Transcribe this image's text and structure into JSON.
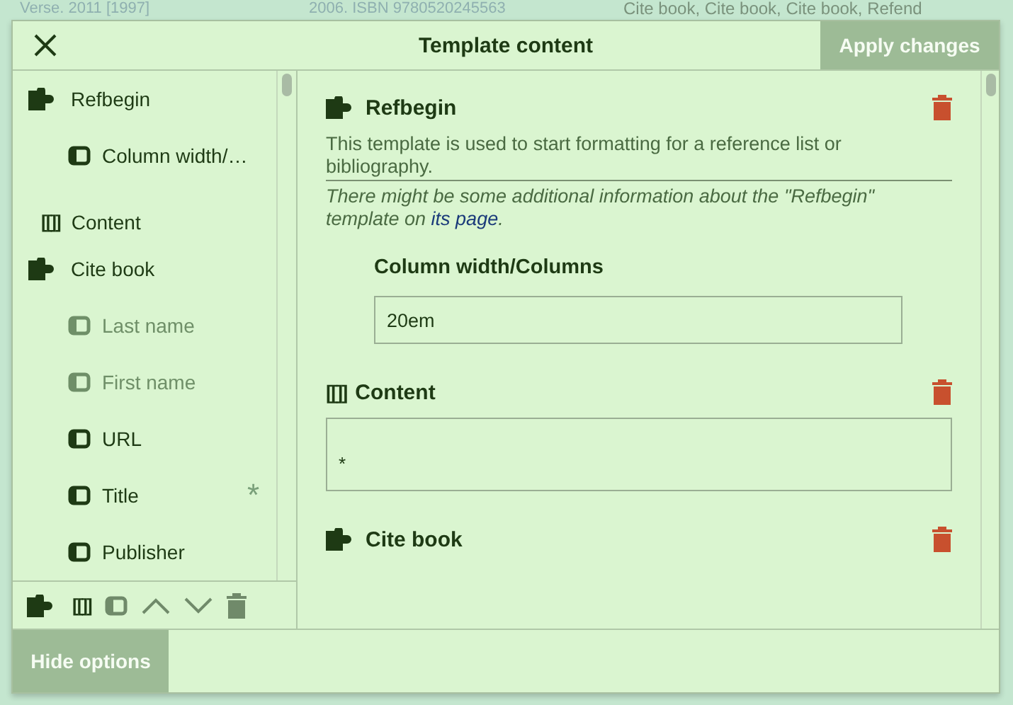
{
  "backdrop": {
    "texts": [
      "Verse. 2011 [1997]",
      "2006. ISBN 9780520245563",
      "Cite book, Cite book, Cite book, Refend"
    ]
  },
  "dialog": {
    "title": "Template content",
    "apply_button": {
      "label": "Apply changes",
      "disabled": true
    },
    "footer_button": "Hide options"
  },
  "sidebar": {
    "items": [
      {
        "kind": "template",
        "label": "Refbegin",
        "disabled": false
      },
      {
        "kind": "param",
        "label": "Column width/…",
        "disabled": false
      },
      {
        "kind": "content",
        "glyph": "[[]]",
        "label": "Content",
        "disabled": false
      },
      {
        "kind": "template",
        "label": "Cite book",
        "disabled": false
      },
      {
        "kind": "param",
        "label": "Last name",
        "disabled": true
      },
      {
        "kind": "param",
        "label": "First name",
        "disabled": true
      },
      {
        "kind": "param",
        "label": "URL",
        "disabled": false
      },
      {
        "kind": "param",
        "label": "Title",
        "disabled": false,
        "required_mark": "*"
      },
      {
        "kind": "param",
        "label": "Publisher",
        "disabled": false
      }
    ],
    "toolbar": [
      {
        "kind": "template",
        "disabled": false
      },
      {
        "kind": "content",
        "glyph": "[[]]",
        "disabled": false
      },
      {
        "kind": "param",
        "disabled": true
      },
      {
        "kind": "up",
        "disabled": true
      },
      {
        "kind": "down",
        "disabled": true
      },
      {
        "kind": "delete",
        "disabled": true
      }
    ]
  },
  "main": {
    "sections": [
      {
        "kind": "template",
        "title": "Refbegin",
        "description": "This template is used to start formatting for a reference list or bibliography.",
        "note": "There might be some additional information about the \"Refbegin\" template on ",
        "note_link": "its page",
        "note_end": ".",
        "params": [
          {
            "label": "Column width/Columns",
            "value": "20em"
          }
        ]
      },
      {
        "kind": "content",
        "glyph": "[[]]",
        "title": "Content",
        "value": "*"
      },
      {
        "kind": "template",
        "title": "Cite book"
      }
    ]
  }
}
